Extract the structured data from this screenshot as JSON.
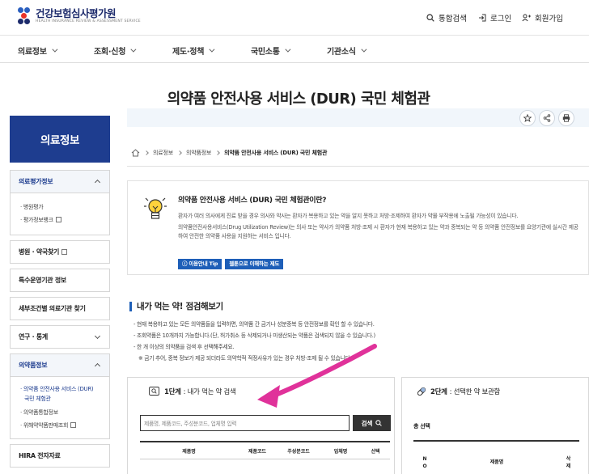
{
  "header": {
    "logo_name": "건강보험심사평가원",
    "logo_sub": "HEALTH INSURANCE REVIEW & ASSESSMENT SERVICE",
    "util": [
      {
        "label": "통합검색",
        "icon": "search-icon"
      },
      {
        "label": "로그인",
        "icon": "login-icon"
      },
      {
        "label": "회원가입",
        "icon": "user-add-icon"
      }
    ]
  },
  "gnb": [
    "의료정보",
    "조회·신청",
    "제도·정책",
    "국민소통",
    "기관소식"
  ],
  "page_title": "의약품 안전사용 서비스 (DUR) 국민 체험관",
  "tools": [
    "star-icon",
    "share-icon",
    "print-icon"
  ],
  "sidebar": {
    "title": "의료정보",
    "items": [
      {
        "label": "의료평가정보",
        "open": true,
        "subs": [
          "· 병원평가",
          "· 평가정보뱅크"
        ]
      },
      {
        "label": "병원 · 약국찾기",
        "ext": true
      },
      {
        "label": "특수운영기관 정보"
      },
      {
        "label": "세부조건별 의료기관 찾기"
      },
      {
        "label": "연구 · 통계",
        "chev": true
      },
      {
        "label": "의약품정보",
        "open": true,
        "subs": [
          "· 의약품 안전사용 서비스 (DUR)",
          "국민 체험관",
          "· 의약품통합정보",
          "· 위해약약품판매조회"
        ]
      },
      {
        "label": "HIRA 전자자료"
      }
    ]
  },
  "breadcrumb": [
    "의료정보",
    "의약품정보",
    "의약품 안전사용 서비스 (DUR) 국민 체험관"
  ],
  "info": {
    "title": "의약품 안전사용 서비스 (DUR) 국민 체험관이란?",
    "p1": "환자가 여러 의사에게 진료 받을 경우 의사와 약사는 환자가 복용하고 있는 약을 알지 못하고 처방·조제하여 환자가 약물 부작용에 노출될 가능성이 있습니다.",
    "p2": "의약품안전사용서비스(Drug Utilization Review)는 의사 또는 약사가 의약품 처방·조제 시 환자가 현재 복용하고 있는 약과 중복되는 약 등 의약품 안전정보를 요양기관에 실시간 제공하여 안전한 의약품 사용을 지원하는 서비스 입니다.",
    "btn1": "ⓘ 이용안내 Tip",
    "btn2": "웹툰으로 이해하는 제도"
  },
  "section": {
    "title": "내가 먹는 약! 점검해보기",
    "notes": [
      "- 현재 복용하고 있는 모든 의약품들을 입력하면, 의약품 간 금기나 성분중복 등 안전정보를 확인 할 수 있습니다.",
      "- 조회약품은 10개까지 가능합니다.(단, 허가취소 등 삭제되거나 미생산되는 약품은 검색되지 않을 수 있습니다.)",
      "- 한 개 이상의 의약품을 검색 후 선택해주세요.",
      "※ 금기 추어, 중복 정보가 제공 되더라도 의약학적 적정사유가 있는 경우 처방·조제 될 수 있습니다."
    ]
  },
  "step1": {
    "head_b": "1단계",
    "head": ": 내가 먹는 약 검색",
    "placeholder": "제품명, 제품코드, 주성분코드, 업체명 입력",
    "btn": "검색",
    "cols": [
      "제품명",
      "제품코드",
      "주성분코드",
      "업체명",
      "선택"
    ]
  },
  "step2": {
    "head_b": "2단계",
    "head": ": 선택한 약 보관함",
    "label": "총 선택",
    "cols": [
      "N\nO",
      "제품명",
      "삭\n제"
    ]
  },
  "colors": {
    "brand": "#1e3d8f",
    "accent": "#1e5fb8",
    "arrow": "#e0329a"
  }
}
